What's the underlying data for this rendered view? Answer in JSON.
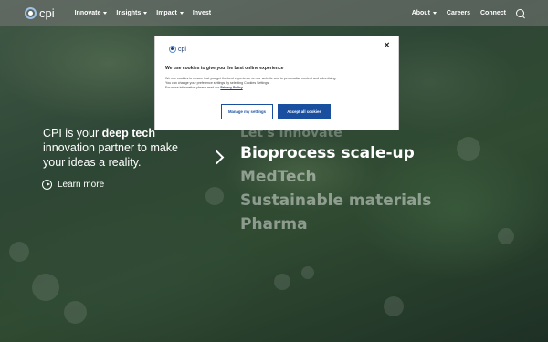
{
  "nav": {
    "logo_text": "cpi",
    "left_items": [
      "Innovate",
      "Insights",
      "Impact",
      "Invest"
    ],
    "right_items": [
      "About",
      "Careers",
      "Connect"
    ]
  },
  "hero": {
    "text_pre": "CPI is your ",
    "text_bold": "deep tech",
    "text_post": " innovation partner to make your ideas a reality.",
    "learn_more": "Learn more",
    "topics": [
      "Let's innovate",
      "Bioprocess scale-up",
      "MedTech",
      "Sustainable materials",
      "Pharma"
    ]
  },
  "cookie_modal": {
    "logo_text": "cpi",
    "close": "✕",
    "title": "We use cookies to give you the best online experience",
    "body_line1": "We use cookies to ensure that you get the best experience on our website and to personalise content and advertising.",
    "body_line2": "You can change your preference settings by selecting Cookies Settings.",
    "body_line3": "For more information please read our",
    "link": "Privacy Policy",
    "manage_button": "Manage my settings",
    "accept_button": "Accept all cookies"
  }
}
